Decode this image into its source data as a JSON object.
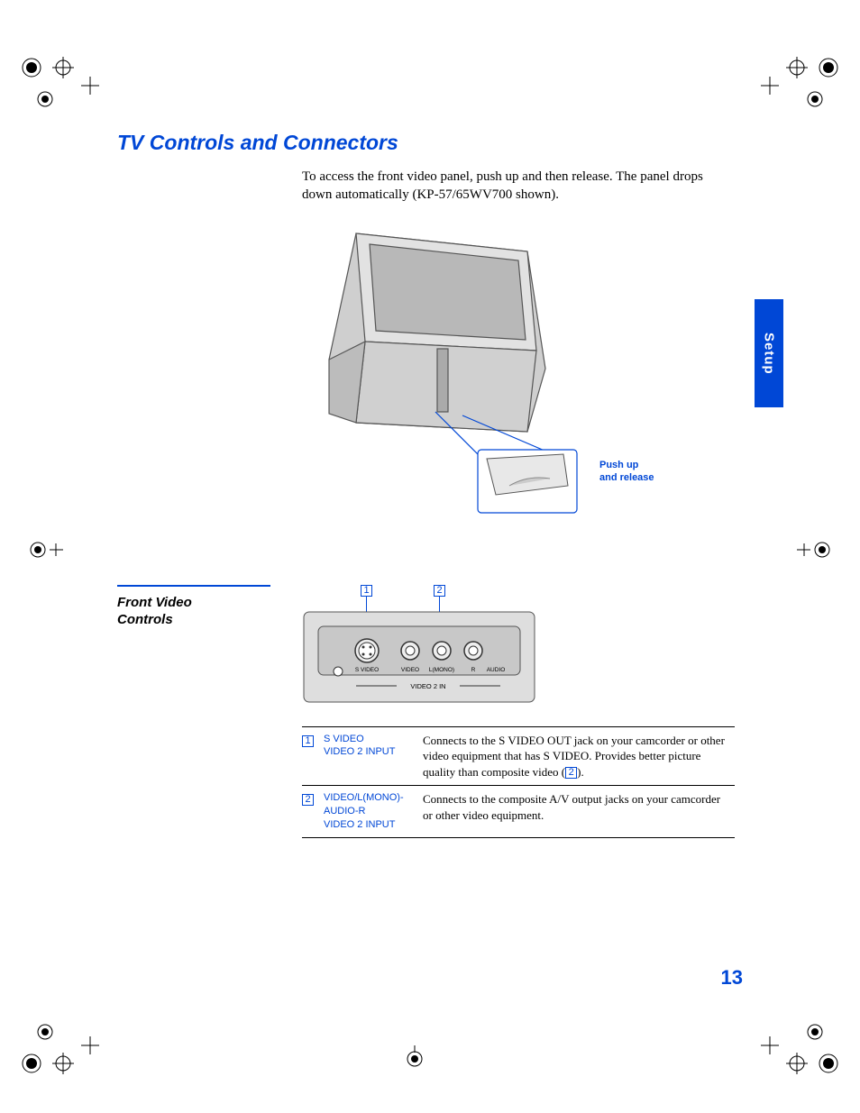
{
  "section_title": "TV Controls and Connectors",
  "intro": "To access the front video panel, push up and then release. The panel drops down automatically (KP-57/65WV700 shown).",
  "callout": "Push up\nand release",
  "side_tab": "Setup",
  "subsection_title": "Front Video\nControls",
  "panel": {
    "callout_1": "1",
    "callout_2": "2",
    "labels": {
      "svideo": "S VIDEO",
      "video": "VIDEO",
      "lmono": "L(MONO)",
      "r": "R",
      "audio": "AUDIO",
      "video2in": "VIDEO 2 IN"
    }
  },
  "table": [
    {
      "num": "1",
      "label": "S VIDEO\nVIDEO 2 INPUT",
      "desc_pre": "Connects to the S VIDEO OUT jack on your camcorder or other video equipment that has S VIDEO. Provides better picture quality than composite video (",
      "desc_ref": "2",
      "desc_post": ")."
    },
    {
      "num": "2",
      "label": "VIDEO/L(MONO)-AUDIO-R\nVIDEO 2 INPUT",
      "desc_pre": "Connects to the composite A/V output jacks on your camcorder or other video equipment.",
      "desc_ref": "",
      "desc_post": ""
    }
  ],
  "page_number": "13"
}
